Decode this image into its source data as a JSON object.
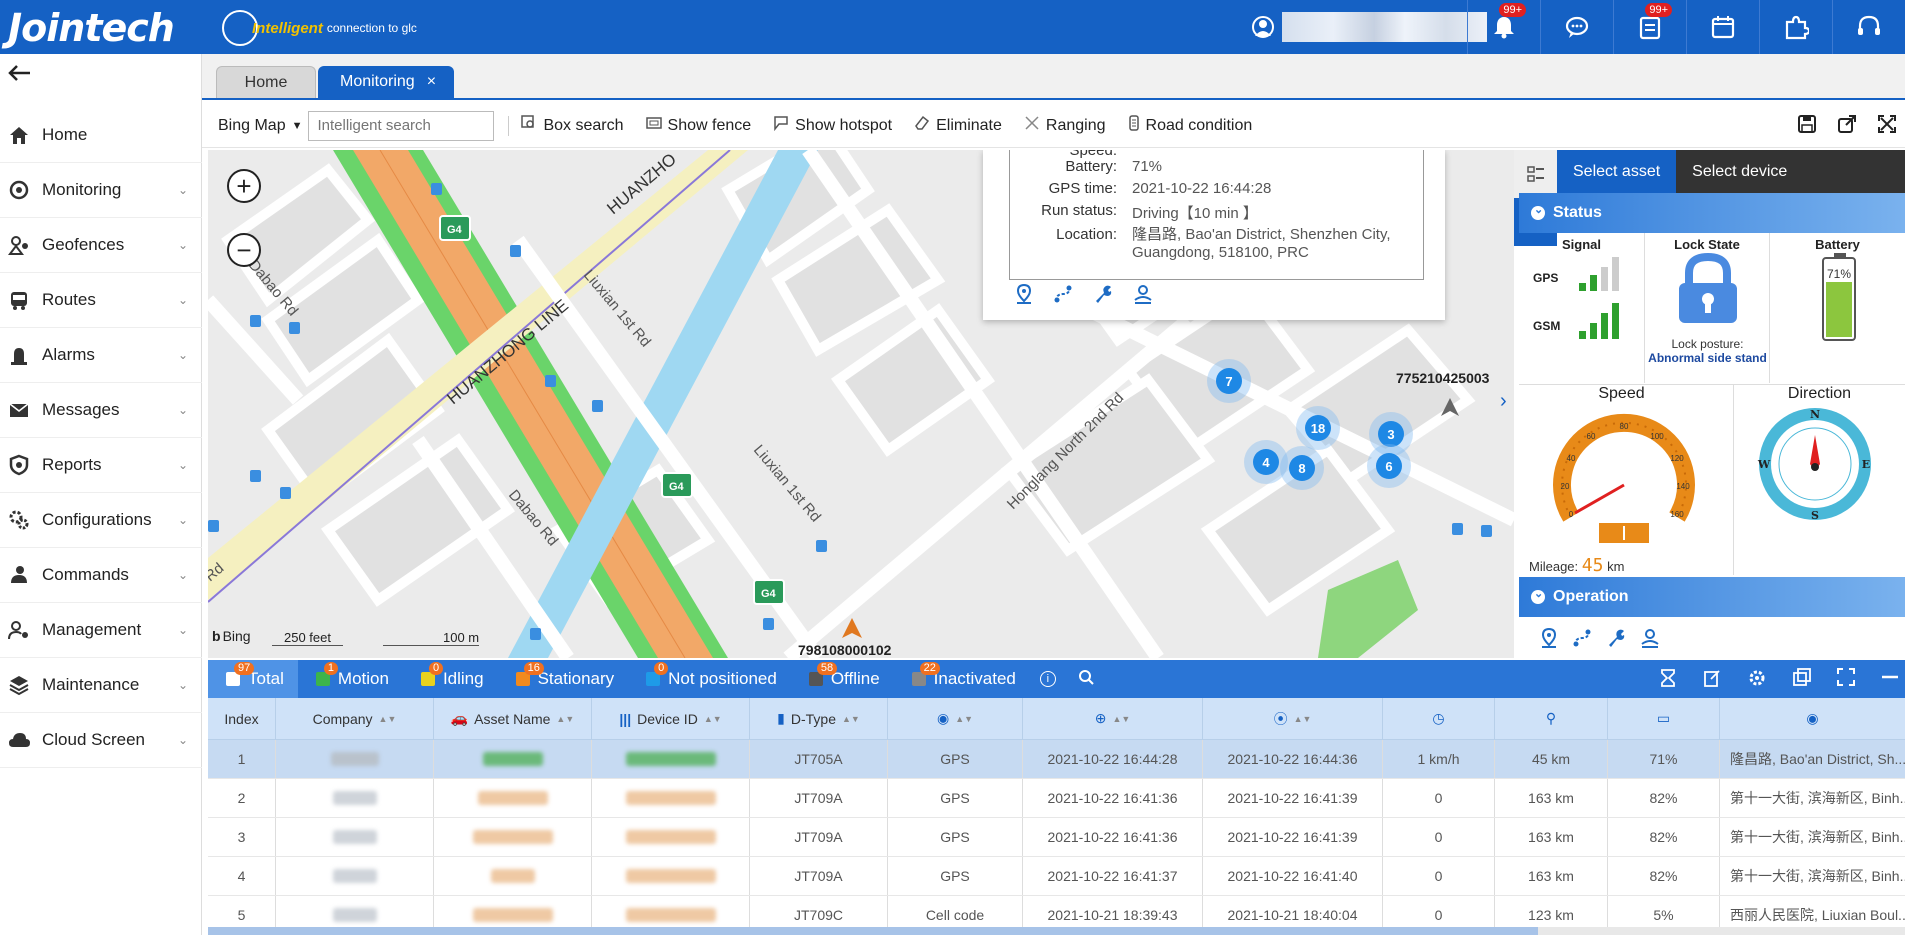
{
  "header": {
    "logo": "Jointech",
    "tagline_brand": "Intelligent",
    "tagline_rest": "connection to glc",
    "badges": {
      "notifications": "99+",
      "tasks": "99+"
    }
  },
  "nav": {
    "back_icon": "arrow-left-icon",
    "items": [
      {
        "label": "Home",
        "icon": "home-icon"
      },
      {
        "label": "Monitoring",
        "icon": "monitor-icon"
      },
      {
        "label": "Geofences",
        "icon": "geofence-icon"
      },
      {
        "label": "Routes",
        "icon": "bus-icon"
      },
      {
        "label": "Alarms",
        "icon": "alarm-icon"
      },
      {
        "label": "Messages",
        "icon": "mail-icon"
      },
      {
        "label": "Reports",
        "icon": "shield-icon"
      },
      {
        "label": "Configurations",
        "icon": "gears-icon"
      },
      {
        "label": "Commands",
        "icon": "command-icon"
      },
      {
        "label": "Management",
        "icon": "people-icon"
      },
      {
        "label": "Maintenance",
        "icon": "layers-icon"
      },
      {
        "label": "Cloud Screen",
        "icon": "cloud-icon"
      }
    ]
  },
  "tabs": {
    "home": "Home",
    "monitoring": "Monitoring",
    "close": "×"
  },
  "toolbar": {
    "map_select": "Bing Map",
    "search_placeholder": "Intelligent search",
    "box_search": "Box search",
    "show_fence": "Show fence",
    "show_hotspot": "Show hotspot",
    "eliminate": "Eliminate",
    "ranging": "Ranging",
    "road_condition": "Road condition"
  },
  "map": {
    "roads": [
      "HUANZHONG LINE",
      "HUANZHO",
      "Liuxian 1st Rd",
      "Liuxian 1st Rd",
      "Dabao Rd",
      "Dabao Rd",
      "Honglang North 2nd Rd",
      "Rd"
    ],
    "shields": [
      "G4",
      "G4",
      "G4"
    ],
    "clusters": [
      "7",
      "18",
      "3",
      "4",
      "8",
      "6"
    ],
    "vehicle_labels": [
      "775210425003",
      "798108000102"
    ],
    "scale_feet": "250 feet",
    "scale_m": "100 m",
    "attribution": "Bing",
    "popup": {
      "speed_label": "Speed:",
      "battery_label": "Battery:",
      "battery": "71%",
      "gps_time_label": "GPS time:",
      "gps_time": "2021-10-22 16:44:28",
      "run_status_label": "Run status:",
      "run_status": "Driving【10 min 】",
      "location_label": "Location:",
      "location": "隆昌路, Bao'an District, Shenzhen City, Guangdong, 518100, PRC"
    }
  },
  "panel": {
    "tabs": [
      "Select asset",
      "Select device"
    ],
    "status_title": "Status",
    "signal_title": "Signal",
    "gps": "GPS",
    "gsm": "GSM",
    "lock_title": "Lock State",
    "lock_label": "Lock posture:",
    "lock_state": "Abnormal side stand",
    "battery_title": "Battery",
    "battery_pct": "71%",
    "battery_level": 0.71,
    "speed_title": "Speed",
    "direction_title": "Direction",
    "mileage_label": "Mileage:",
    "mileage_value": "45",
    "mileage_unit": "km",
    "speed_ticks": [
      "0",
      "20",
      "40",
      "60",
      "80",
      "100",
      "120",
      "140",
      "160"
    ],
    "compass": [
      "N",
      "E",
      "S",
      "W"
    ],
    "operation_title": "Operation"
  },
  "filters": [
    {
      "label": "Total",
      "count": "97",
      "color": "#ffffff"
    },
    {
      "label": "Motion",
      "count": "1",
      "color": "#3cb44b"
    },
    {
      "label": "Idling",
      "count": "0",
      "color": "#e8d21d"
    },
    {
      "label": "Stationary",
      "count": "16",
      "color": "#f28a1e"
    },
    {
      "label": "Not positioned",
      "count": "0",
      "color": "#1e9be8"
    },
    {
      "label": "Offline",
      "count": "58",
      "color": "#555555"
    },
    {
      "label": "Inactivated",
      "count": "22",
      "color": "#888888"
    }
  ],
  "table": {
    "columns": [
      "Index",
      "Company",
      "Asset Name",
      "Device ID",
      "D-Type",
      "",
      "",
      "",
      "",
      "",
      "",
      ""
    ],
    "rows": [
      {
        "index": "1",
        "dtype": "JT705A",
        "pos": "GPS",
        "gps_time": "2021-10-22 16:44:28",
        "recv_time": "2021-10-22 16:44:36",
        "speed": "1 km/h",
        "mileage": "45 km",
        "battery": "71%",
        "location": "隆昌路, Bao'an District, Sh..."
      },
      {
        "index": "2",
        "dtype": "JT709A",
        "pos": "GPS",
        "gps_time": "2021-10-22 16:41:36",
        "recv_time": "2021-10-22 16:41:39",
        "speed": "0",
        "mileage": "163 km",
        "battery": "82%",
        "location": "第十一大街, 滨海新区, Binh..."
      },
      {
        "index": "3",
        "dtype": "JT709A",
        "pos": "GPS",
        "gps_time": "2021-10-22 16:41:36",
        "recv_time": "2021-10-22 16:41:39",
        "speed": "0",
        "mileage": "163 km",
        "battery": "82%",
        "location": "第十一大街, 滨海新区, Binh..."
      },
      {
        "index": "4",
        "dtype": "JT709A",
        "pos": "GPS",
        "gps_time": "2021-10-22 16:41:37",
        "recv_time": "2021-10-22 16:41:40",
        "speed": "0",
        "mileage": "163 km",
        "battery": "82%",
        "location": "第十一大街, 滨海新区, Binh..."
      },
      {
        "index": "5",
        "dtype": "JT709C",
        "pos": "Cell code",
        "gps_time": "2021-10-21 18:39:43",
        "recv_time": "2021-10-21 18:40:04",
        "speed": "0",
        "mileage": "123 km",
        "battery": "5%",
        "location": "西丽人民医院, Liuxian Boul..."
      }
    ]
  }
}
